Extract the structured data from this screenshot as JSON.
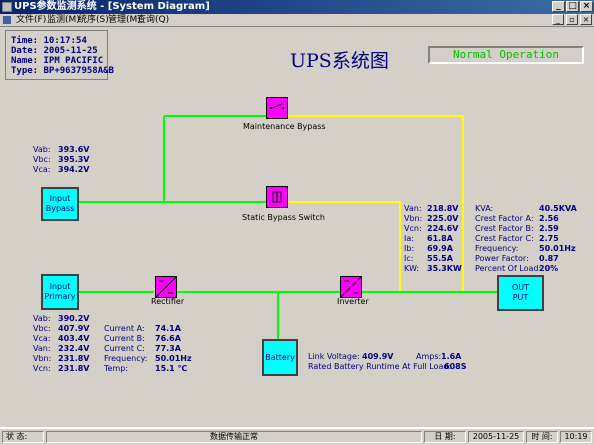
{
  "window": {
    "title": "UPS参数监测系统 - [System Diagram]",
    "controls": [
      "_",
      "□",
      "×"
    ]
  },
  "menu": {
    "items": [
      "文件(F)",
      "监测(M)",
      "统序(S)",
      "管理(M)",
      "查询(Q)"
    ],
    "mdi_controls": [
      "_",
      "▫",
      "×"
    ]
  },
  "info": {
    "time": "Time:  10:17:54",
    "date": "Date:  2005-11-25",
    "name": "Name:  IPM PACIFIC",
    "type": "Type:  BP+9637958A&B"
  },
  "diagram_title": "UPS系统图",
  "status": "Normal Operation",
  "bypass_voltages": {
    "labels": [
      "Vab:",
      "Vbc:",
      "Vca:"
    ],
    "values": [
      "393.6V",
      "395.3V",
      "394.2V"
    ]
  },
  "primary_voltages": {
    "labels": [
      "Vab:",
      "Vbc:",
      "Vca:",
      "Van:",
      "Vbn:",
      "Vcn:"
    ],
    "values": [
      "390.2V",
      "407.9V",
      "403.4V",
      "232.4V",
      "231.8V",
      "231.8V"
    ]
  },
  "primary_currents": {
    "labels": [
      "Current A:",
      "Current B:",
      "Current C:",
      "Frequency:",
      "Temp:"
    ],
    "values": [
      "74.1A",
      "76.6A",
      "77.3A",
      "50.01Hz",
      "15.1 ℃"
    ]
  },
  "output_phase": {
    "labels": [
      "Van:",
      "Vbn:",
      "Vcn:",
      "Ia:",
      "Ib:",
      "Ic:",
      "KW:"
    ],
    "values": [
      "218.8V",
      "225.0V",
      "224.6V",
      "61.8A",
      "69.9A",
      "55.5A",
      "35.3KW"
    ]
  },
  "output_stats": {
    "labels": [
      "KVA:",
      "Crest Factor A:",
      "Crest Factor B:",
      "Crest Factor C:",
      "Frequency:",
      "Power Factor:",
      "Percent Of Load:"
    ],
    "values": [
      "40.5KVA",
      "2.56",
      "2.59",
      "2.75",
      "50.01Hz",
      "0.87",
      "20%"
    ]
  },
  "battery": {
    "link_voltage_label": "Link Voltage:",
    "link_voltage": "409.9V",
    "amps_label": "Amps:",
    "amps": "1.6A",
    "runtime_label": "Rated Battery Runtime At Full Load:",
    "runtime": "608S"
  },
  "blocks": {
    "input_bypass": "Input\nBypass",
    "input_primary": "Input\nPrimary",
    "battery": "Battery",
    "output": "OUT\nPUT"
  },
  "captions": {
    "maintenance_bypass": "Maintenance Bypass",
    "static_bypass_switch": "Static Bypass Switch",
    "rectifier": "Rectifier",
    "inverter": "Inverter"
  },
  "statusbar": {
    "status_label": "状 态:",
    "status_text": "数据传输正常",
    "date_label": "日 期:",
    "date": "2005-11-25",
    "time_label": "时 间:",
    "time": "10:19"
  },
  "colors": {
    "green_line": "#00ff00",
    "yellow_line": "#ffff00",
    "block_fill": "#00ffff",
    "switch_fill": "#ff00ff",
    "text_blue": "#000080",
    "status_green": "#00c000"
  }
}
